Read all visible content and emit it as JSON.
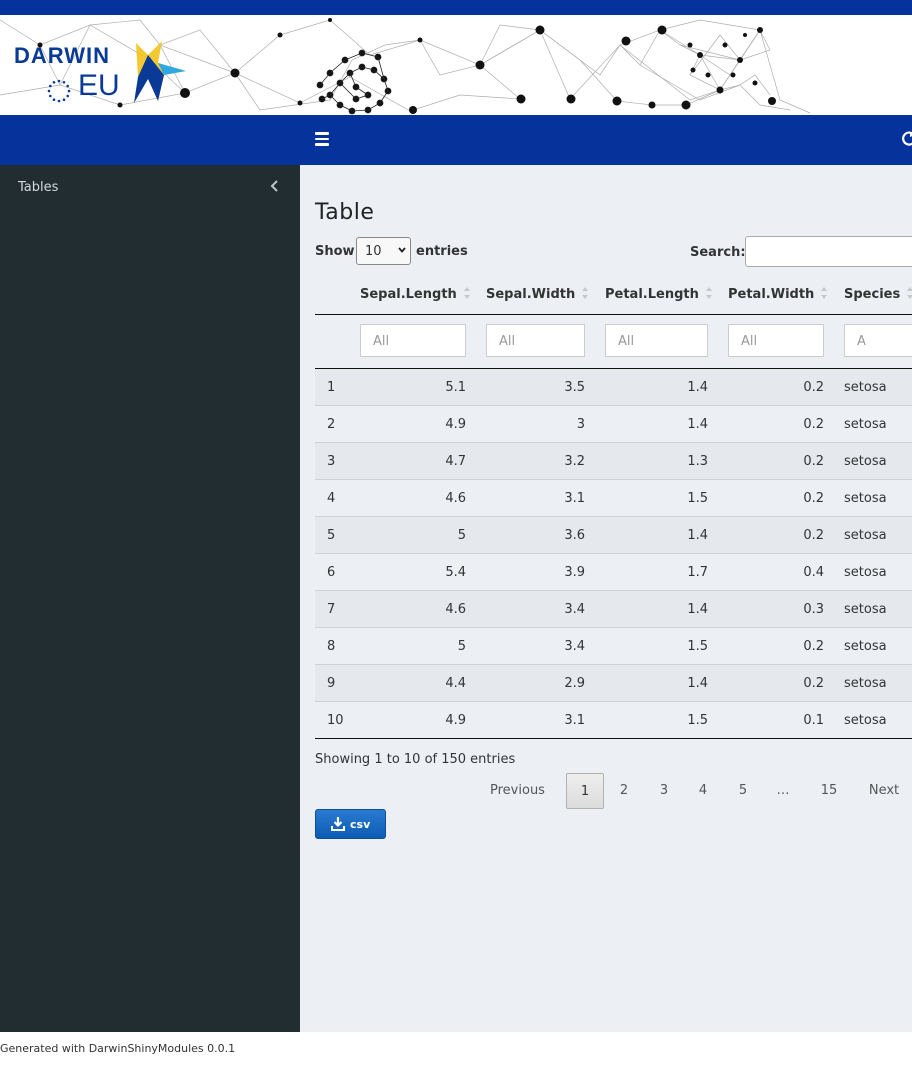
{
  "brand": {
    "logo_text_1": "DARWIN",
    "logo_text_2": "EU",
    "primary_color": "#05329b",
    "sidebar_color": "#222d32",
    "content_bg": "#ecf0f5"
  },
  "navbar": {
    "menu_icon": "hamburger-icon",
    "refresh_icon": "refresh-icon"
  },
  "sidebar": {
    "items": [
      {
        "label": "Tables",
        "icon": "chevron-left-icon"
      }
    ]
  },
  "page": {
    "title": "Table"
  },
  "table_controls": {
    "show_label": "Show",
    "entries_label": "entries",
    "page_length": "10",
    "search_label": "Search:",
    "search_value": ""
  },
  "table": {
    "columns": [
      "",
      "Sepal.Length",
      "Sepal.Width",
      "Petal.Length",
      "Petal.Width",
      "Species"
    ],
    "filters": [
      "All",
      "All",
      "All",
      "All",
      "A"
    ],
    "rows": [
      [
        "1",
        "5.1",
        "3.5",
        "1.4",
        "0.2",
        "setosa"
      ],
      [
        "2",
        "4.9",
        "3",
        "1.4",
        "0.2",
        "setosa"
      ],
      [
        "3",
        "4.7",
        "3.2",
        "1.3",
        "0.2",
        "setosa"
      ],
      [
        "4",
        "4.6",
        "3.1",
        "1.5",
        "0.2",
        "setosa"
      ],
      [
        "5",
        "5",
        "3.6",
        "1.4",
        "0.2",
        "setosa"
      ],
      [
        "6",
        "5.4",
        "3.9",
        "1.7",
        "0.4",
        "setosa"
      ],
      [
        "7",
        "4.6",
        "3.4",
        "1.4",
        "0.3",
        "setosa"
      ],
      [
        "8",
        "5",
        "3.4",
        "1.5",
        "0.2",
        "setosa"
      ],
      [
        "9",
        "4.4",
        "2.9",
        "1.4",
        "0.2",
        "setosa"
      ],
      [
        "10",
        "4.9",
        "3.1",
        "1.5",
        "0.1",
        "setosa"
      ]
    ]
  },
  "info": "Showing 1 to 10 of 150 entries",
  "pagination": {
    "previous": "Previous",
    "pages": [
      "1",
      "2",
      "3",
      "4",
      "5",
      "…",
      "15"
    ],
    "active": "1",
    "next": "Next"
  },
  "download": {
    "label": "csv",
    "icon": "download-icon"
  },
  "footer": "Generated with DarwinShinyModules 0.0.1"
}
